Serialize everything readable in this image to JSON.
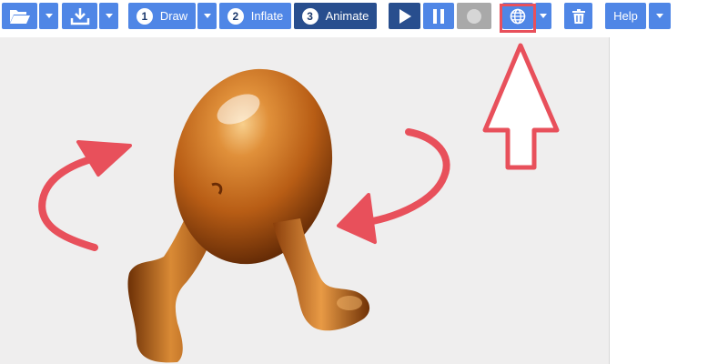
{
  "toolbar": {
    "open_icon": "folder-open-icon",
    "download_icon": "download-icon",
    "steps": [
      {
        "number": "1",
        "label": "Draw"
      },
      {
        "number": "2",
        "label": "Inflate"
      },
      {
        "number": "3",
        "label": "Animate"
      }
    ],
    "play_icon": "play-icon",
    "pause_icon": "pause-icon",
    "record_icon": "record-icon",
    "globe_icon": "globe-icon",
    "trash_icon": "trash-icon",
    "help_label": "Help"
  },
  "colors": {
    "button_blue": "#4f86e6",
    "active_step": "#284e8e",
    "disabled_gray": "#a9a9a9",
    "annotation_red": "#e8505b",
    "canvas_bg": "#efeeee"
  },
  "canvas": {
    "subject": "inflated-3d-egg-character"
  }
}
